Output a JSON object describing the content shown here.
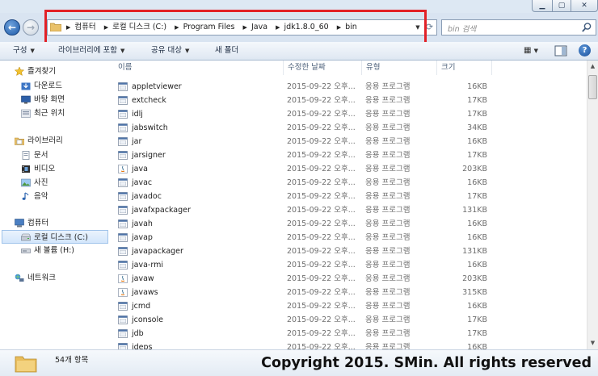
{
  "window": {
    "minimize": "▁",
    "maximize": "▢",
    "close": "✕"
  },
  "address_bar": {
    "breadcrumbs": [
      "컴퓨터",
      "로컬 디스크 (C:)",
      "Program Files",
      "Java",
      "jdk1.8.0_60",
      "bin"
    ]
  },
  "search": {
    "placeholder": "bin 검색"
  },
  "toolbar": {
    "organize": "구성",
    "include_library": "라이브러리에 포함",
    "share": "공유 대상",
    "new_folder": "새 폴더"
  },
  "nav": {
    "favorites": "즐겨찾기",
    "downloads": "다운로드",
    "desktop": "바탕 화면",
    "recent": "최근 위치",
    "libraries": "라이브러리",
    "documents": "문서",
    "videos": "비디오",
    "pictures": "사진",
    "music": "음악",
    "computer": "컴퓨터",
    "local_disk": "로컬 디스크 (C:)",
    "new_volume": "새 볼륨 (H:)",
    "network": "네트워크"
  },
  "columns": {
    "name": "이름",
    "date": "수정한 날짜",
    "type": "유형",
    "size": "크기"
  },
  "files": [
    {
      "name": "appletviewer",
      "date": "2015-09-22 오후...",
      "type": "응용 프로그램",
      "size": "16KB",
      "icon": "exe-icon"
    },
    {
      "name": "extcheck",
      "date": "2015-09-22 오후...",
      "type": "응용 프로그램",
      "size": "17KB",
      "icon": "exe-icon"
    },
    {
      "name": "idlj",
      "date": "2015-09-22 오후...",
      "type": "응용 프로그램",
      "size": "17KB",
      "icon": "exe-icon"
    },
    {
      "name": "jabswitch",
      "date": "2015-09-22 오후...",
      "type": "응용 프로그램",
      "size": "34KB",
      "icon": "exe-icon"
    },
    {
      "name": "jar",
      "date": "2015-09-22 오후...",
      "type": "응용 프로그램",
      "size": "16KB",
      "icon": "exe-icon"
    },
    {
      "name": "jarsigner",
      "date": "2015-09-22 오후...",
      "type": "응용 프로그램",
      "size": "17KB",
      "icon": "exe-icon"
    },
    {
      "name": "java",
      "date": "2015-09-22 오후...",
      "type": "응용 프로그램",
      "size": "203KB",
      "icon": "java-icon"
    },
    {
      "name": "javac",
      "date": "2015-09-22 오후...",
      "type": "응용 프로그램",
      "size": "16KB",
      "icon": "exe-icon"
    },
    {
      "name": "javadoc",
      "date": "2015-09-22 오후...",
      "type": "응용 프로그램",
      "size": "17KB",
      "icon": "exe-icon"
    },
    {
      "name": "javafxpackager",
      "date": "2015-09-22 오후...",
      "type": "응용 프로그램",
      "size": "131KB",
      "icon": "exe-icon"
    },
    {
      "name": "javah",
      "date": "2015-09-22 오후...",
      "type": "응용 프로그램",
      "size": "16KB",
      "icon": "exe-icon"
    },
    {
      "name": "javap",
      "date": "2015-09-22 오후...",
      "type": "응용 프로그램",
      "size": "16KB",
      "icon": "exe-icon"
    },
    {
      "name": "javapackager",
      "date": "2015-09-22 오후...",
      "type": "응용 프로그램",
      "size": "131KB",
      "icon": "exe-icon"
    },
    {
      "name": "java-rmi",
      "date": "2015-09-22 오후...",
      "type": "응용 프로그램",
      "size": "16KB",
      "icon": "exe-icon"
    },
    {
      "name": "javaw",
      "date": "2015-09-22 오후...",
      "type": "응용 프로그램",
      "size": "203KB",
      "icon": "java-icon"
    },
    {
      "name": "javaws",
      "date": "2015-09-22 오후...",
      "type": "응용 프로그램",
      "size": "315KB",
      "icon": "java-icon"
    },
    {
      "name": "jcmd",
      "date": "2015-09-22 오후...",
      "type": "응용 프로그램",
      "size": "16KB",
      "icon": "exe-icon"
    },
    {
      "name": "jconsole",
      "date": "2015-09-22 오후...",
      "type": "응용 프로그램",
      "size": "17KB",
      "icon": "exe-icon"
    },
    {
      "name": "jdb",
      "date": "2015-09-22 오후...",
      "type": "응용 프로그램",
      "size": "17KB",
      "icon": "exe-icon"
    },
    {
      "name": "jdeps",
      "date": "2015-09-22 오후...",
      "type": "응용 프로그램",
      "size": "16KB",
      "icon": "exe-icon"
    }
  ],
  "status": {
    "item_count": "54개 항목"
  },
  "watermark": {
    "text": "Copyright 2015. SMin. All rights reserved"
  },
  "colors": {
    "highlight": "#e22127",
    "selection": "#d3e6fb",
    "accent": "#1d59a8"
  }
}
